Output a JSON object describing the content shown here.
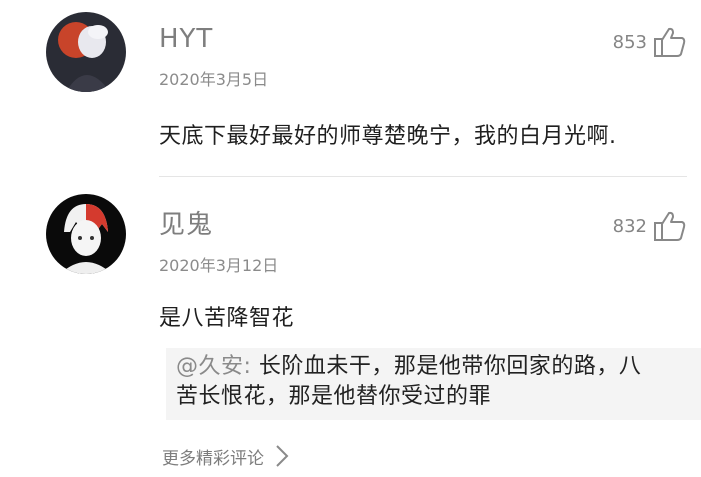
{
  "comments": [
    {
      "username": "HYT",
      "date": "2020年3月5日",
      "likes": "853",
      "content": "天底下最好最好的师尊楚晚宁，我的白月光啊."
    },
    {
      "username": "见鬼",
      "date": "2020年3月12日",
      "likes": "832",
      "content": "是八苦降智花",
      "reply": {
        "user": "@久安:",
        "text": " 长阶血未干，那是他带你回家的路，八苦长恨花，那是他替你受过的罪"
      }
    }
  ],
  "more_label": "更多精彩评论",
  "icons": {
    "like": "thumbs-up-icon",
    "more": "chevron-right-icon"
  }
}
